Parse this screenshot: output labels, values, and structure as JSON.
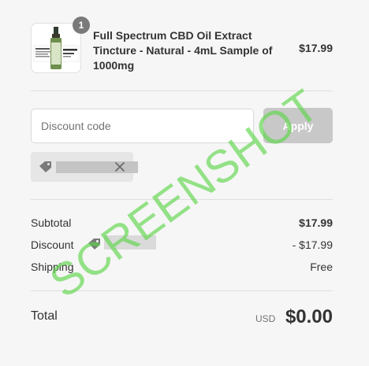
{
  "product": {
    "quantity": "1",
    "name": "Full Spectrum CBD Oil Extract Tincture - Natural - 4mL Sample of 1000mg",
    "price": "$17.99"
  },
  "discount_form": {
    "placeholder": "Discount code",
    "apply_label": "Apply"
  },
  "summary": {
    "subtotal_label": "Subtotal",
    "subtotal_value": "$17.99",
    "discount_label": "Discount",
    "discount_value": "- $17.99",
    "shipping_label": "Shipping",
    "shipping_value": "Free"
  },
  "total": {
    "label": "Total",
    "currency": "USD",
    "value": "$0.00"
  },
  "watermark": "SCREENSHOT",
  "colors": {
    "background": "#f6f6f6",
    "watermark": "#5ed64a",
    "apply_disabled": "#c8c8c8",
    "badge": "#7a7a7a"
  },
  "icons": [
    "bottle-thumbnail",
    "tag-icon",
    "close-icon"
  ]
}
